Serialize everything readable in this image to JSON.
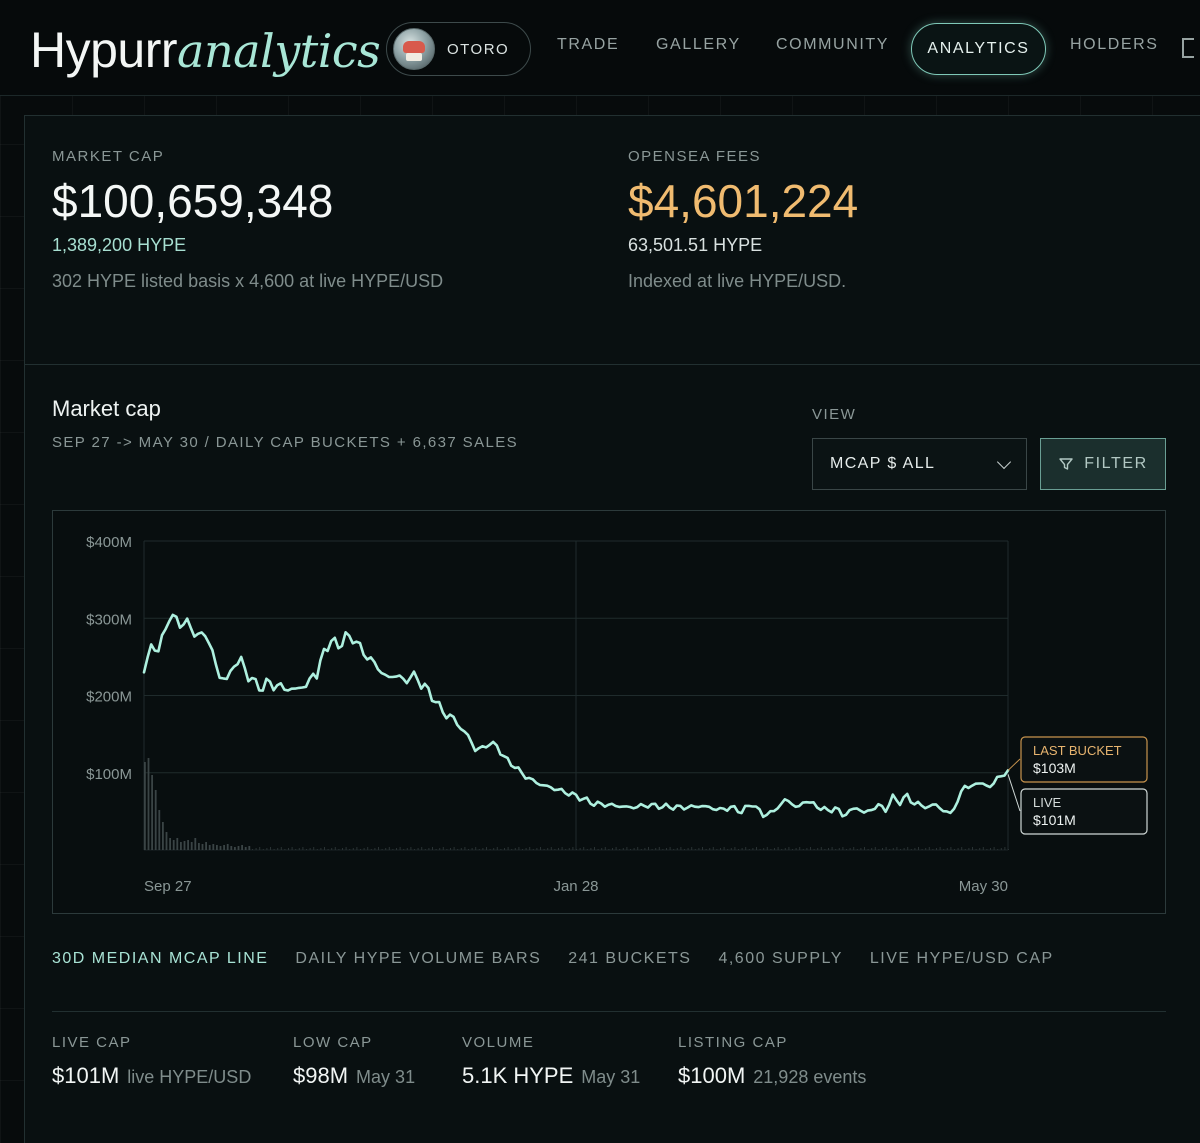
{
  "nav": {
    "logo_main": "Hypurr",
    "logo_accent": "analytics",
    "token_label": "OTORO",
    "items": [
      {
        "label": "TRADE"
      },
      {
        "label": "GALLERY"
      },
      {
        "label": "COMMUNITY"
      },
      {
        "label": "ANALYTICS"
      },
      {
        "label": "HOLDERS"
      }
    ]
  },
  "summary": {
    "market_cap": {
      "label": "MARKET CAP",
      "value": "$100,659,348",
      "hype": "1,389,200 HYPE",
      "note": "302 HYPE listed basis x 4,600 at live HYPE/USD"
    },
    "opensea_fees": {
      "label": "OPENSEA FEES",
      "value": "$4,601,224",
      "hype": "63,501.51 HYPE",
      "note": "Indexed at live HYPE/USD."
    }
  },
  "chart_section": {
    "title": "Market cap",
    "subtitle": "SEP 27 -> MAY 30 / DAILY CAP BUCKETS + 6,637 SALES",
    "view_label": "VIEW",
    "view_value": "MCAP $ ALL",
    "filter_label": "FILTER"
  },
  "colors": {
    "accent": "#a8e3d5",
    "line": "#aef0df",
    "orange": "#f0bb70"
  },
  "chart_data": {
    "type": "line",
    "ylim": [
      0,
      400
    ],
    "yticks": [
      {
        "value": 100,
        "label": "$100M"
      },
      {
        "value": 200,
        "label": "$200M"
      },
      {
        "value": 300,
        "label": "$300M"
      },
      {
        "value": 400,
        "label": "$400M"
      }
    ],
    "xticks": [
      {
        "index": 0,
        "label": "Sep 27"
      },
      {
        "index": 120,
        "label": "Jan 28"
      },
      {
        "index": 240,
        "label": "May 30"
      }
    ],
    "n": 241,
    "mcap_anchors": [
      [
        0,
        230
      ],
      [
        2,
        265
      ],
      [
        4,
        258
      ],
      [
        7,
        302
      ],
      [
        10,
        295
      ],
      [
        13,
        290
      ],
      [
        15,
        275
      ],
      [
        17,
        282
      ],
      [
        19,
        255
      ],
      [
        21,
        225
      ],
      [
        23,
        220
      ],
      [
        25,
        240
      ],
      [
        27,
        245
      ],
      [
        29,
        225
      ],
      [
        31,
        215
      ],
      [
        33,
        210
      ],
      [
        35,
        218
      ],
      [
        37,
        210
      ],
      [
        39,
        212
      ],
      [
        41,
        205
      ],
      [
        43,
        212
      ],
      [
        45,
        210
      ],
      [
        47,
        230
      ],
      [
        48,
        225
      ],
      [
        50,
        258
      ],
      [
        52,
        270
      ],
      [
        54,
        265
      ],
      [
        56,
        275
      ],
      [
        58,
        275
      ],
      [
        60,
        262
      ],
      [
        62,
        250
      ],
      [
        64,
        242
      ],
      [
        66,
        230
      ],
      [
        68,
        222
      ],
      [
        70,
        228
      ],
      [
        72,
        218
      ],
      [
        74,
        225
      ],
      [
        76,
        222
      ],
      [
        78,
        210
      ],
      [
        80,
        200
      ],
      [
        82,
        185
      ],
      [
        84,
        175
      ],
      [
        86,
        170
      ],
      [
        88,
        158
      ],
      [
        90,
        148
      ],
      [
        92,
        130
      ],
      [
        94,
        132
      ],
      [
        96,
        138
      ],
      [
        98,
        135
      ],
      [
        100,
        120
      ],
      [
        103,
        108
      ],
      [
        106,
        95
      ],
      [
        110,
        85
      ],
      [
        115,
        78
      ],
      [
        120,
        70
      ],
      [
        125,
        60
      ],
      [
        130,
        58
      ],
      [
        135,
        55
      ],
      [
        140,
        58
      ],
      [
        145,
        56
      ],
      [
        150,
        55
      ],
      [
        155,
        57
      ],
      [
        160,
        52
      ],
      [
        163,
        55
      ],
      [
        166,
        50
      ],
      [
        169,
        60
      ],
      [
        172,
        45
      ],
      [
        175,
        50
      ],
      [
        178,
        65
      ],
      [
        180,
        60
      ],
      [
        182,
        55
      ],
      [
        184,
        65
      ],
      [
        186,
        58
      ],
      [
        188,
        55
      ],
      [
        190,
        50
      ],
      [
        192,
        55
      ],
      [
        194,
        45
      ],
      [
        196,
        50
      ],
      [
        198,
        55
      ],
      [
        200,
        48
      ],
      [
        202,
        52
      ],
      [
        204,
        58
      ],
      [
        206,
        52
      ],
      [
        208,
        68
      ],
      [
        210,
        62
      ],
      [
        212,
        70
      ],
      [
        214,
        60
      ],
      [
        216,
        58
      ],
      [
        218,
        55
      ],
      [
        220,
        60
      ],
      [
        222,
        50
      ],
      [
        224,
        48
      ],
      [
        226,
        62
      ],
      [
        228,
        85
      ],
      [
        230,
        80
      ],
      [
        232,
        90
      ],
      [
        234,
        80
      ],
      [
        236,
        88
      ],
      [
        238,
        95
      ],
      [
        240,
        103
      ]
    ],
    "volume_bars": [
      88,
      92,
      75,
      60,
      40,
      28,
      18,
      12,
      10,
      12,
      8,
      9,
      10,
      8,
      12,
      7,
      6,
      8,
      5,
      6,
      5,
      4,
      5,
      6,
      4,
      3,
      4,
      5,
      3,
      4
    ],
    "tags": [
      {
        "label": "LAST BUCKET",
        "value": "$103M",
        "kind": "last"
      },
      {
        "label": "LIVE",
        "value": "$101M",
        "kind": "live"
      }
    ]
  },
  "legend": [
    {
      "label": "30D MEDIAN MCAP LINE",
      "accent": true
    },
    {
      "label": "DAILY HYPE VOLUME BARS",
      "accent": false
    },
    {
      "label": "241 BUCKETS",
      "accent": false
    },
    {
      "label": "4,600 SUPPLY",
      "accent": false
    },
    {
      "label": "LIVE HYPE/USD CAP",
      "accent": false
    }
  ],
  "stats": [
    {
      "label": "LIVE CAP",
      "value": "$101M",
      "note": "live HYPE/USD"
    },
    {
      "label": "LOW CAP",
      "value": "$98M",
      "note": "May 31"
    },
    {
      "label": "VOLUME",
      "value": "5.1K HYPE",
      "note": "May 31"
    },
    {
      "label": "LISTING CAP",
      "value": "$100M",
      "note": "21,928 events"
    }
  ]
}
